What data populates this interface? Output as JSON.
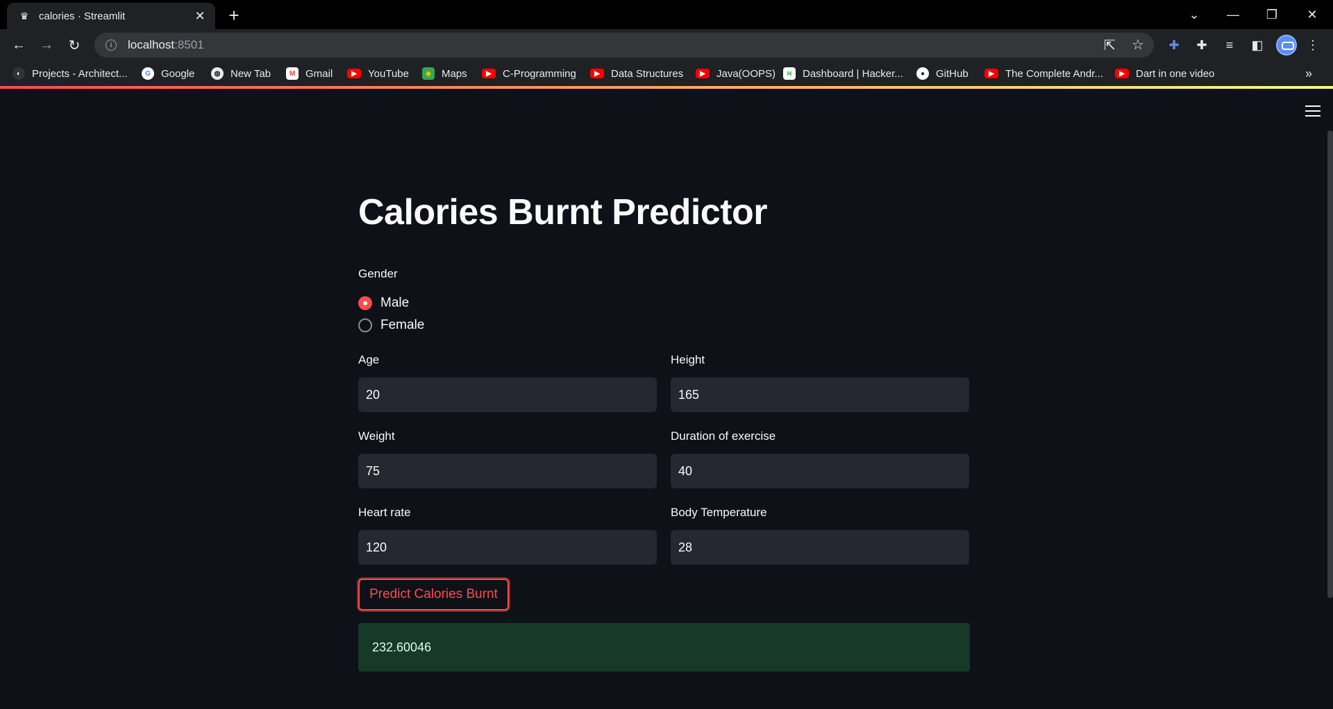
{
  "browser": {
    "tab": {
      "title": "calories · Streamlit"
    },
    "url": {
      "host": "localhost",
      "port": ":8501"
    },
    "bookmarks": [
      {
        "label": "Projects - Architect...",
        "icon": "architect-icon"
      },
      {
        "label": "Google",
        "icon": "google-icon"
      },
      {
        "label": "New Tab",
        "icon": "globe-icon"
      },
      {
        "label": "Gmail",
        "icon": "gmail-icon"
      },
      {
        "label": "YouTube",
        "icon": "youtube-icon"
      },
      {
        "label": "Maps",
        "icon": "maps-icon"
      },
      {
        "label": "C-Programming",
        "icon": "youtube-icon"
      },
      {
        "label": "Data Structures",
        "icon": "youtube-icon"
      },
      {
        "label": "Java(OOPS)",
        "icon": "youtube-icon"
      },
      {
        "label": "Dashboard | Hacker...",
        "icon": "hackerrank-icon"
      },
      {
        "label": "GitHub",
        "icon": "github-icon"
      },
      {
        "label": "The Complete Andr...",
        "icon": "youtube-icon"
      },
      {
        "label": "Dart in one video",
        "icon": "youtube-icon"
      }
    ],
    "more_bookmarks": "»"
  },
  "app": {
    "title": "Calories Burnt Predictor",
    "gender": {
      "label": "Gender",
      "options": [
        "Male",
        "Female"
      ],
      "selected": "Male"
    },
    "fields": {
      "age": {
        "label": "Age",
        "value": "20"
      },
      "height": {
        "label": "Height",
        "value": "165"
      },
      "weight": {
        "label": "Weight",
        "value": "75"
      },
      "duration": {
        "label": "Duration of exercise",
        "value": "40"
      },
      "heart_rate": {
        "label": "Heart rate",
        "value": "120"
      },
      "body_temp": {
        "label": "Body Temperature",
        "value": "28"
      }
    },
    "predict_button": "Predict Calories Burnt",
    "result": "232.60046"
  },
  "colors": {
    "accent": "#ff4b4b",
    "background": "#0e1117",
    "input_bg": "#262730",
    "success_bg": "#173928"
  }
}
